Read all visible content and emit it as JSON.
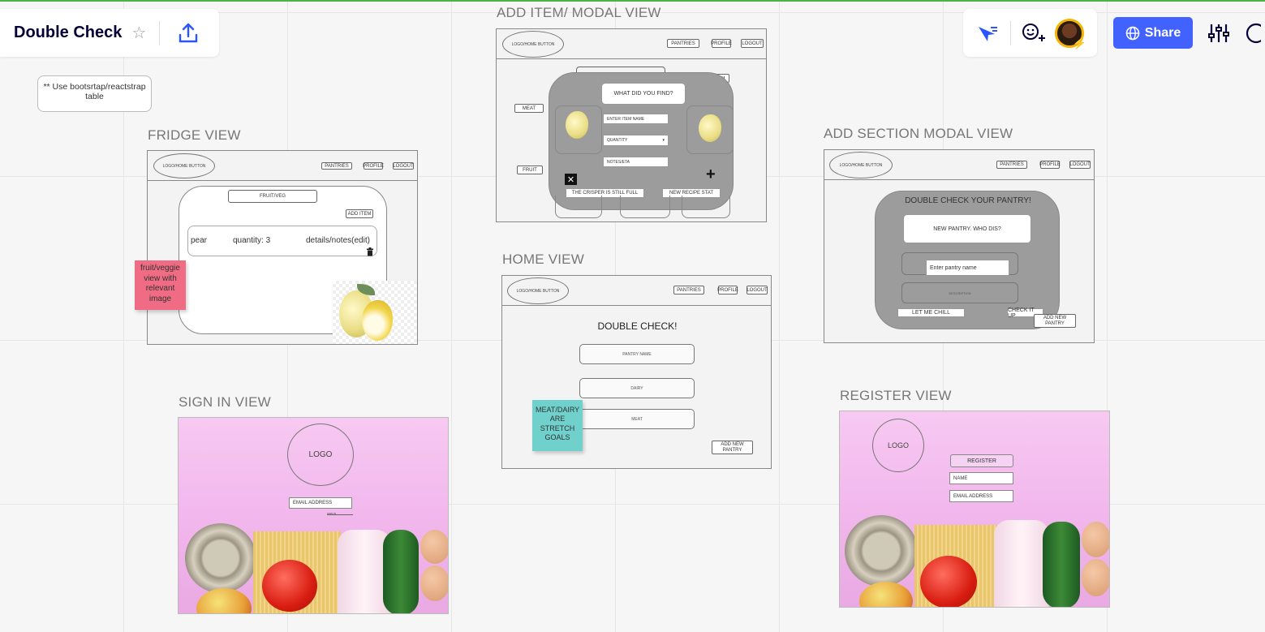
{
  "board": {
    "title": "Double Check",
    "share_label": "Share"
  },
  "comment": {
    "text": "** Use bootsrtap/reactstrap table"
  },
  "labels": {
    "fridge": "FRIDGE VIEW",
    "add_item": "ADD ITEM/ MODAL VIEW",
    "add_section": "ADD SECTION MODAL VIEW",
    "home": "HOME VIEW",
    "sign_in": "SIGN IN VIEW",
    "register": "REGISTER VIEW"
  },
  "nav": {
    "logo": "LOGO/HOME BUTTON",
    "pantries": "PANTRIES",
    "profile": "PROFILE",
    "logout": "LOGOUT"
  },
  "fridge": {
    "section_title": "FRUIT/VEG",
    "add_item": "ADD ITEM",
    "item_name": "pear",
    "item_qty": "quantity: 3",
    "item_details": "details/notes(edit)"
  },
  "sticky_pink": {
    "text": "fruit/veggie view with relevant image"
  },
  "sticky_teal": {
    "text": "MEAT/DAIRY ARE STRETCH GOALS"
  },
  "add_item_modal": {
    "section_box": "SECTION NAME",
    "add_item": "ADD ITEM",
    "meat": "MEAT",
    "fruit": "FRUIT",
    "title": "WHAT DID YOU FIND?",
    "name_input": "ENTER ITEM NAME",
    "qty_select": "QUANTITY",
    "notes_input": "NOTES/ETA",
    "cancel_btn": "THE CRISPER IS STILL FULL",
    "submit_btn": "NEW RECIPE STAT"
  },
  "home": {
    "title": "DOUBLE CHECK!",
    "pantry1": "PANTRY NAME",
    "pantry2": "DAIRY",
    "pantry3": "MEAT",
    "add_pantry": "ADD NEW PANTRY"
  },
  "add_section_modal": {
    "title": "DOUBLE CHECK YOUR PANTRY!",
    "subtitle": "NEW PANTRY. WHO DIS?",
    "name_input": "Enter pantry name",
    "desc_box": "DESCRIPTION",
    "cancel_btn": "LET ME CHILL",
    "submit_btn": "CHECK IT UP",
    "add_pantry": "ADD NEW PANTRY"
  },
  "sign_in": {
    "logo": "LOGO",
    "email_input": "EMAIL ADDRESS",
    "link": "SIGN IN"
  },
  "register": {
    "logo": "LOGO",
    "register_btn": "REGISTER",
    "name_input": "NAME",
    "email_input": "EMAIL ADDRESS"
  },
  "colors": {
    "accent": "#4262ff",
    "sticky_pink": "#f06c84",
    "sticky_teal": "#6fd0cc",
    "modal_grey": "#9c9c9c"
  },
  "icons": [
    "star-icon",
    "export-icon",
    "cursor-icon",
    "reaction-icon",
    "globe-icon",
    "settings-sliders-icon",
    "help-icon",
    "trash-icon",
    "plus-icon",
    "close-icon"
  ]
}
